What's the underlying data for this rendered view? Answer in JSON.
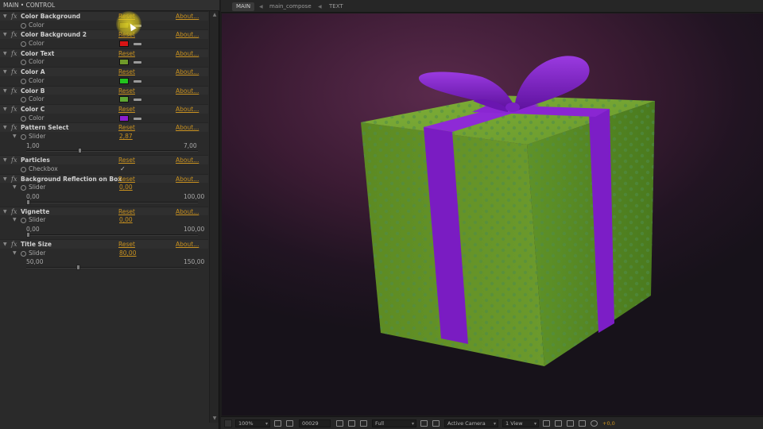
{
  "panel": {
    "header": "MAIN • CONTROL"
  },
  "effects": [
    {
      "name": "Color Background",
      "reset": "Reset",
      "about": "About...",
      "param": {
        "label": "Color",
        "kind": "color",
        "color": "#6a6a22"
      }
    },
    {
      "name": "Color Background 2",
      "reset": "Reset",
      "about": "About...",
      "param": {
        "label": "Color",
        "kind": "color",
        "color": "#d81414"
      }
    },
    {
      "name": "Color Text",
      "reset": "Reset",
      "about": "About...",
      "param": {
        "label": "Color",
        "kind": "color",
        "color": "#6f9a2a"
      }
    },
    {
      "name": "Color A",
      "reset": "Reset",
      "about": "About...",
      "param": {
        "label": "Color",
        "kind": "color",
        "color": "#22c41e"
      }
    },
    {
      "name": "Color B",
      "reset": "Reset",
      "about": "About...",
      "param": {
        "label": "Color",
        "kind": "color",
        "color": "#5fa834"
      }
    },
    {
      "name": "Color C",
      "reset": "Reset",
      "about": "About...",
      "param": {
        "label": "Color",
        "kind": "color",
        "color": "#8a1ed2"
      }
    },
    {
      "name": "Pattern Select",
      "reset": "Reset",
      "about": "About...",
      "param": {
        "label": "Slider",
        "kind": "slider",
        "value": "2,87",
        "min": "1,00",
        "max": "7,00",
        "fraction": 0.31
      }
    },
    {
      "name": "Particles",
      "reset": "Reset",
      "about": "About...",
      "param": {
        "label": "Checkbox",
        "kind": "checkbox",
        "checked": true
      }
    },
    {
      "name": "Background Reflection on Box",
      "reset": "Reset",
      "about": "About...",
      "param": {
        "label": "Slider",
        "kind": "slider",
        "value": "0,00",
        "min": "0,00",
        "max": "100,00",
        "fraction": 0.0
      }
    },
    {
      "name": "Vignette",
      "reset": "Reset",
      "about": "About...",
      "param": {
        "label": "Slider",
        "kind": "slider",
        "value": "0,00",
        "min": "0,00",
        "max": "100,00",
        "fraction": 0.0
      }
    },
    {
      "name": "Title Size",
      "reset": "Reset",
      "about": "About...",
      "param": {
        "label": "Slider",
        "kind": "slider",
        "value": "80,00",
        "min": "50,00",
        "max": "150,00",
        "fraction": 0.3
      }
    }
  ],
  "icons": {
    "effect": "fx-icon",
    "stopwatch": "stopwatch-icon",
    "eyedropper": "eyedropper-icon",
    "cursor": "mouse-cursor-icon"
  },
  "viewer": {
    "breadcrumbs": [
      "MAIN",
      "main_compose",
      "TEXT"
    ],
    "colors": {
      "box": "#6b9a2a",
      "ribbon": "#7c1cc4",
      "background": "#3b1b33"
    }
  },
  "bottom_bar": {
    "zoom": "100%",
    "timecode": "00029",
    "resolution": "Full",
    "camera": "Active Camera",
    "view": "1 View",
    "exposure": "+0,0"
  }
}
